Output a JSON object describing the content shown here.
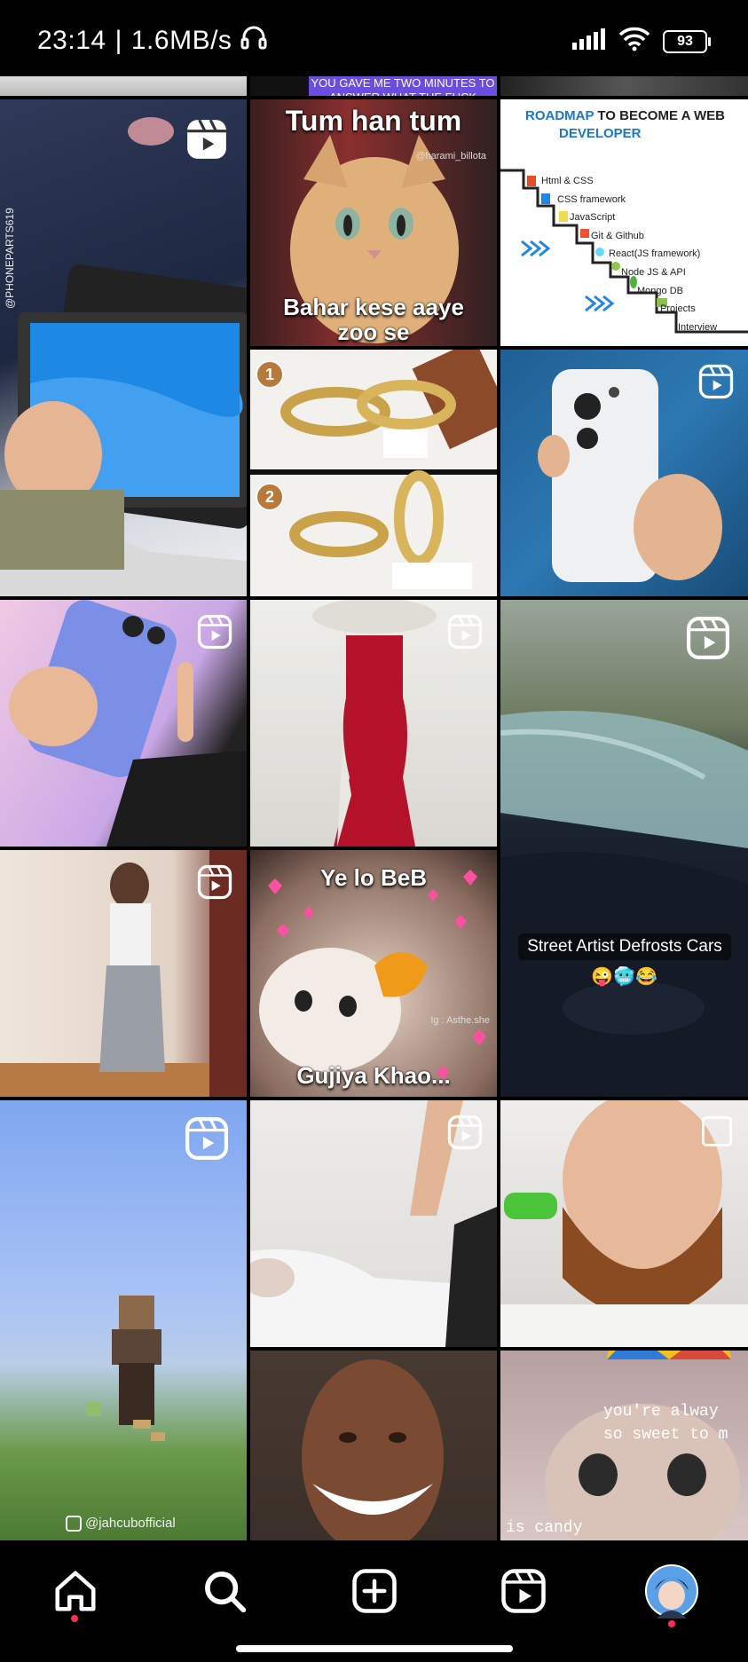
{
  "status_bar": {
    "time": "23:14",
    "separator": "|",
    "net_speed": "1.6MB/s",
    "battery": "93"
  },
  "banner": {
    "text": "YOU GAVE ME TWO MINUTES TO ANSWER WHAT THE FUCK"
  },
  "tiles": {
    "tablet": {
      "label": "@PHONEPARTS619"
    },
    "cat_meme": {
      "top": "Tum han tum",
      "bottom": "Bahar kese aaye zoo se",
      "credit": "@harami_billota"
    },
    "roadmap": {
      "title_a": "ROADMAP",
      "title_b": "TO BECOME A WEB",
      "title_c": "DEVELOPER",
      "steps": [
        "Html & CSS",
        "CSS framework",
        "JavaScript",
        "Git & Github",
        "React(JS framework)",
        "Node JS & API",
        "Mongo DB",
        "Projects",
        "Interview"
      ]
    },
    "rings": {
      "badge1": "1",
      "badge2": "2"
    },
    "frost": {
      "caption": "Street Artist Defrosts Cars",
      "emojis": "😜🥶😂"
    },
    "cat_gujiya": {
      "top": "Ye lo BeB",
      "bottom": "Gujiya Khao...",
      "credit": "Ig : Asthe.she"
    },
    "minecraft": {
      "handle": "@jahcubofficial"
    },
    "cat_sweet": {
      "line1": "you're alway",
      "line2": "so sweet to m",
      "line3": "is candy"
    }
  },
  "nav": {
    "items": [
      "home-icon",
      "search-icon",
      "create-icon",
      "reels-icon",
      "profile-avatar"
    ]
  },
  "colors": {
    "accent": "#ff2d55",
    "banner_bg": "#6a4ee0"
  }
}
